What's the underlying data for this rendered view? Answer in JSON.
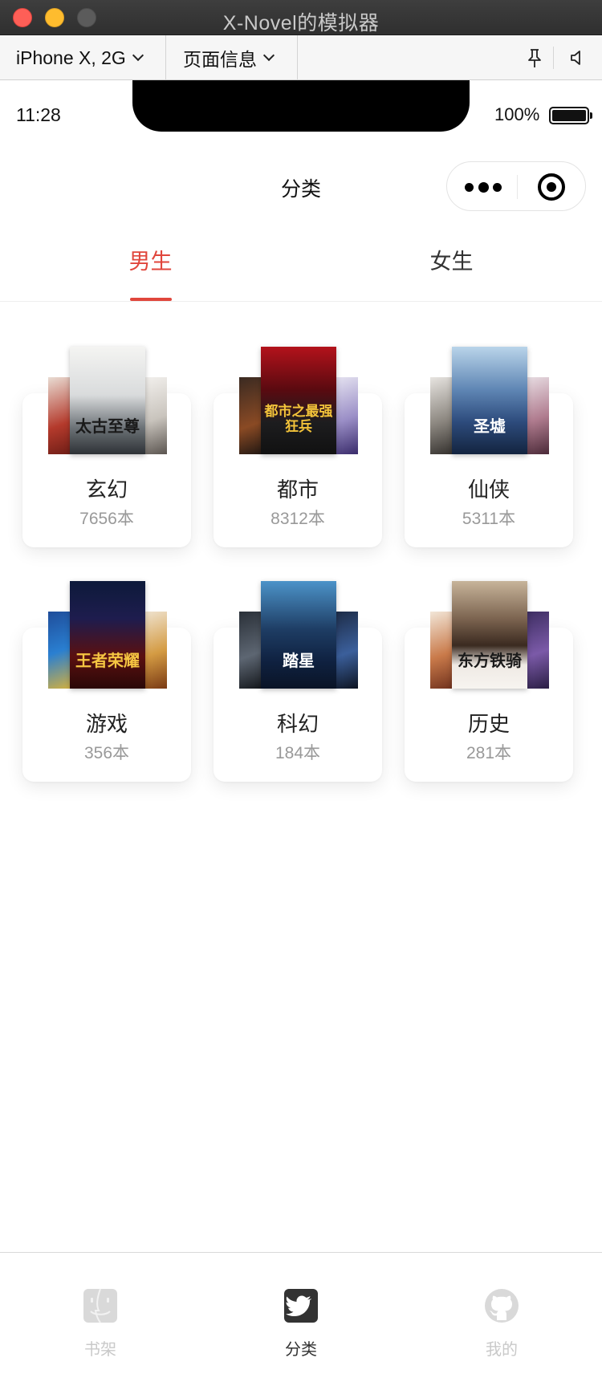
{
  "window": {
    "title": "X-Novel的模拟器"
  },
  "toolbar": {
    "device": "iPhone X, 2G",
    "page_info": "页面信息",
    "icons": [
      "pin-icon",
      "speaker-icon"
    ]
  },
  "status_bar": {
    "time": "11:28",
    "battery": "100%"
  },
  "nav": {
    "title": "分类"
  },
  "tabs": [
    {
      "label": "男生",
      "active": true
    },
    {
      "label": "女生",
      "active": false
    }
  ],
  "categories": [
    {
      "name": "玄幻",
      "count": "7656本",
      "cover_text": "太古至尊"
    },
    {
      "name": "都市",
      "count": "8312本",
      "cover_text": "都市之最强狂兵"
    },
    {
      "name": "仙侠",
      "count": "5311本",
      "cover_text": "圣墟"
    },
    {
      "name": "游戏",
      "count": "356本",
      "cover_text": "王者荣耀"
    },
    {
      "name": "科幻",
      "count": "184本",
      "cover_text": "踏星"
    },
    {
      "name": "历史",
      "count": "281本",
      "cover_text": "东方铁骑"
    }
  ],
  "tabbar": [
    {
      "label": "书架",
      "icon": "finder-icon",
      "active": false
    },
    {
      "label": "分类",
      "icon": "twitter-icon",
      "active": true
    },
    {
      "label": "我的",
      "icon": "github-icon",
      "active": false
    }
  ],
  "colors": {
    "accent": "#e0463c",
    "muted": "#999999",
    "tab_inactive": "#c9c9c9"
  }
}
